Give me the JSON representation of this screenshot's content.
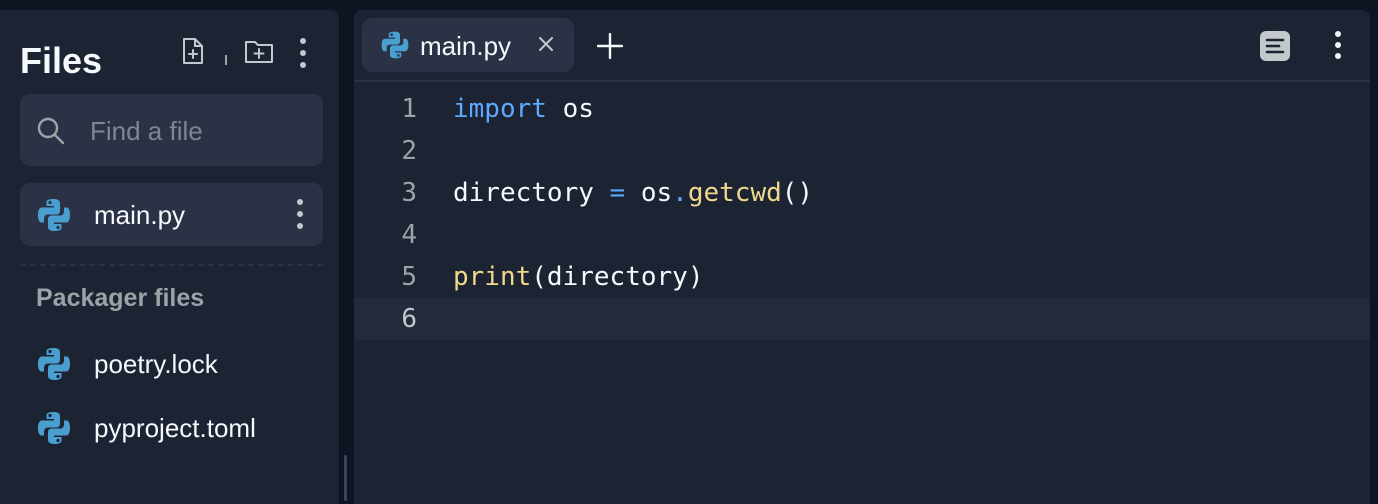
{
  "sidebar": {
    "title": "Files",
    "actions": {
      "new_file_icon": "file-plus-icon",
      "new_folder_icon": "folder-plus-icon",
      "menu_icon": "kebab-icon"
    },
    "search": {
      "placeholder": "Find a file",
      "value": ""
    },
    "files": [
      {
        "name": "main.py",
        "icon": "python-icon",
        "selected": true
      }
    ],
    "packager_section": {
      "label": "Packager files",
      "files": [
        {
          "name": "poetry.lock",
          "icon": "python-icon"
        },
        {
          "name": "pyproject.toml",
          "icon": "python-icon"
        }
      ]
    }
  },
  "editor": {
    "tabs": [
      {
        "label": "main.py",
        "icon": "python-icon",
        "active": true
      }
    ],
    "lines": [
      {
        "number": "1",
        "tokens": [
          {
            "t": "import",
            "c": "kw"
          },
          {
            "t": " os",
            "c": ""
          }
        ]
      },
      {
        "number": "2",
        "tokens": []
      },
      {
        "number": "3",
        "tokens": [
          {
            "t": "directory ",
            "c": ""
          },
          {
            "t": "=",
            "c": "op"
          },
          {
            "t": " os",
            "c": ""
          },
          {
            "t": ".",
            "c": "op"
          },
          {
            "t": "getcwd",
            "c": "fn"
          },
          {
            "t": "()",
            "c": ""
          }
        ]
      },
      {
        "number": "4",
        "tokens": []
      },
      {
        "number": "5",
        "tokens": [
          {
            "t": "print",
            "c": "fn"
          },
          {
            "t": "(directory)",
            "c": ""
          }
        ]
      },
      {
        "number": "6",
        "tokens": [],
        "current": true
      }
    ]
  },
  "colors": {
    "background": "#0f1422",
    "panel": "#1c2333",
    "selected": "#2b3245",
    "keyword": "#5ea9ff",
    "function": "#f0d88b",
    "text": "#f5f9fc"
  }
}
